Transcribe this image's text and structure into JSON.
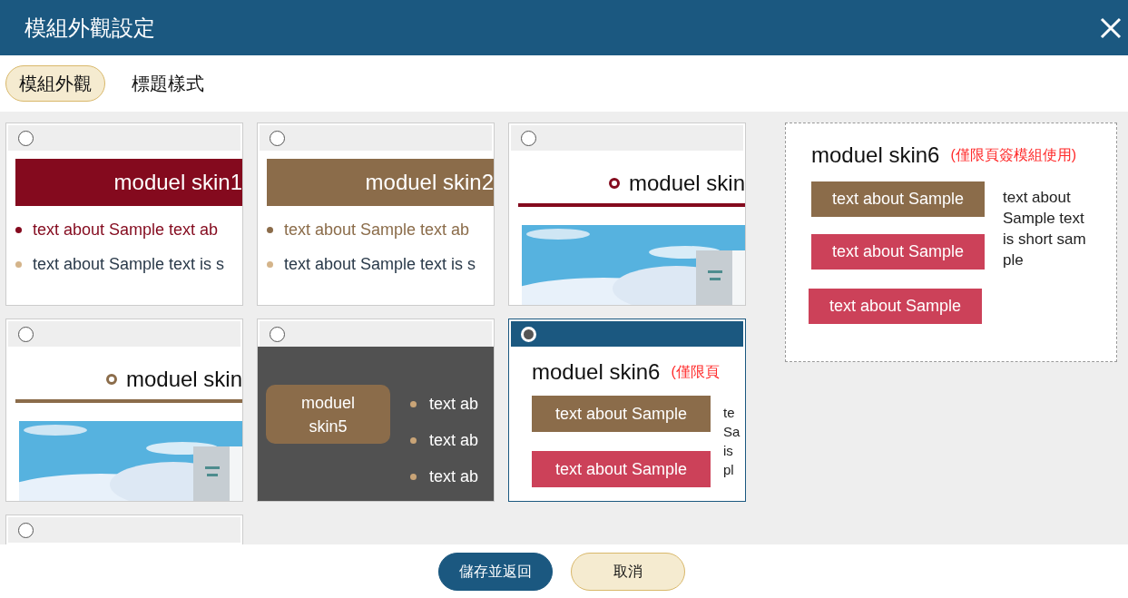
{
  "window": {
    "title": "模組外觀設定"
  },
  "tabs": [
    {
      "label": "模組外觀",
      "selected": true
    },
    {
      "label": "標題樣式",
      "selected": false
    }
  ],
  "skins": [
    {
      "kind": "banner",
      "selected": false,
      "color": "#840a1e",
      "title": "moduel skin1",
      "lines": [
        "text about Sample  text ab",
        "text about Sample text is s"
      ]
    },
    {
      "kind": "banner",
      "selected": false,
      "color": "#8b6c4a",
      "title": "moduel skin2",
      "lines": [
        "text about Sample  text ab",
        "text about Sample text is s"
      ]
    },
    {
      "kind": "underline",
      "selected": false,
      "color": "#840a1e",
      "title": "moduel skin"
    },
    {
      "kind": "underline",
      "selected": false,
      "color": "#8b6c4a",
      "title": "moduel skin"
    },
    {
      "kind": "dark",
      "selected": false,
      "color": "#8b6c4a",
      "title": "moduel skin5",
      "lines": [
        "text ab",
        "text ab",
        "text ab"
      ]
    },
    {
      "kind": "buttons",
      "selected": true,
      "color": "#cc4159",
      "title": "moduel skin6",
      "note": "(僅限頁",
      "buttons": [
        "text about Sample",
        "text about Sample"
      ],
      "side": "te Sa is pl"
    },
    {
      "kind": "blank",
      "selected": false
    }
  ],
  "preview": {
    "title": "moduel skin6",
    "note": "(僅限頁簽模組使用)",
    "buttons": [
      "text about Sample",
      "text about Sample",
      "text about Sample"
    ],
    "side": "text about Sample text is short sam ple"
  },
  "buttons": [
    {
      "label": "儲存並返回",
      "kind": "primary"
    },
    {
      "label": "取消",
      "kind": "secondary"
    }
  ]
}
